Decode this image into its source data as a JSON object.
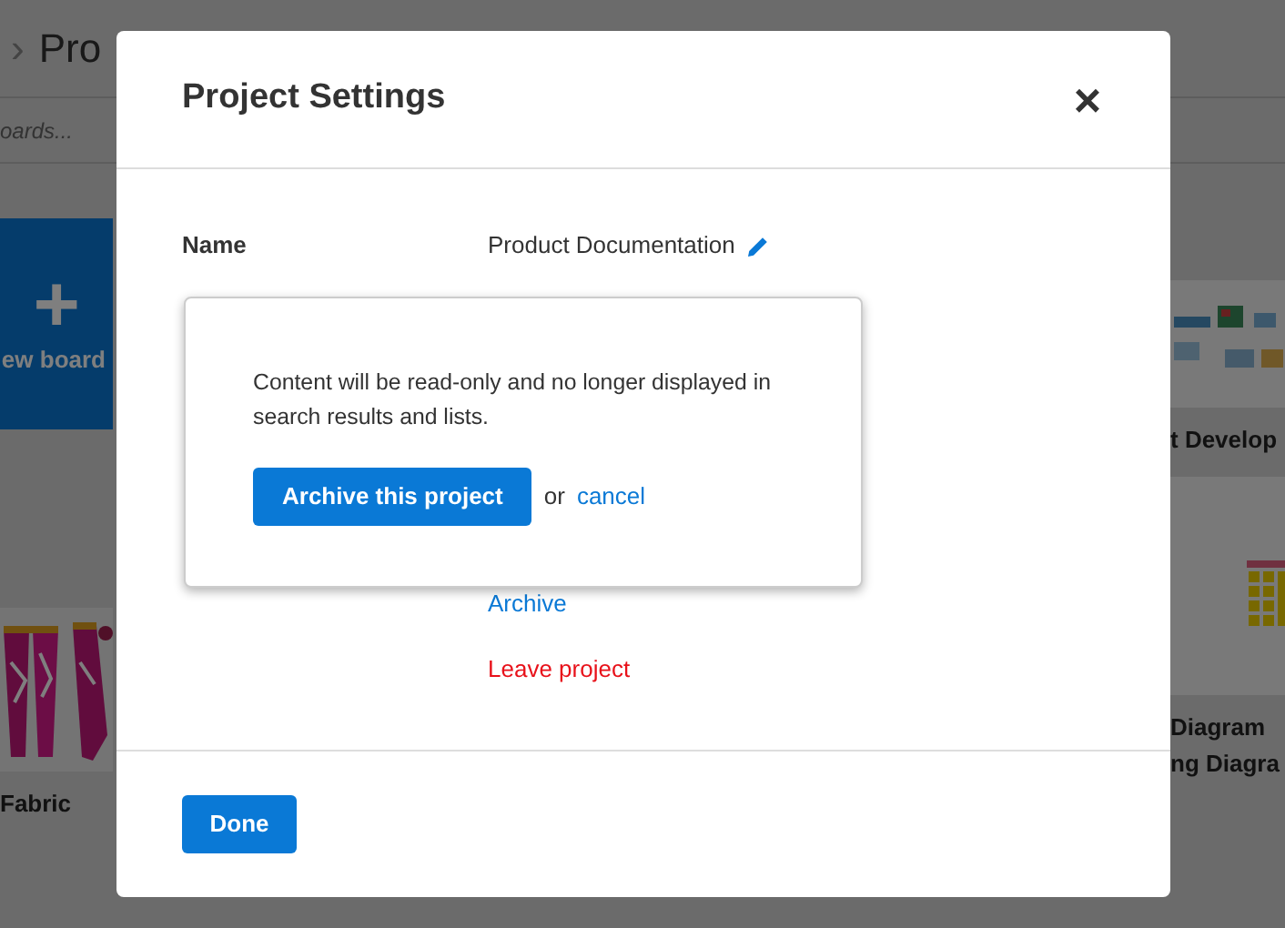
{
  "background": {
    "breadcrumb": {
      "separator": "›",
      "title": "Pro"
    },
    "search": {
      "placeholder": "oards..."
    },
    "new_board": {
      "icon": "+",
      "label": "ew board"
    },
    "left_boards": [
      {
        "kind": "picture",
        "title_lines": [
          "Fabric"
        ]
      }
    ],
    "right_boards": [
      {
        "kind": "picture",
        "title_lines": [
          "t Develop"
        ]
      },
      {
        "kind": "picture",
        "title_lines": [
          "Diagram",
          "ng Diagra"
        ]
      }
    ]
  },
  "modal": {
    "title": "Project Settings",
    "close": "×",
    "fields": [
      {
        "label": "Name",
        "value": "Product Documentation",
        "editable": true
      }
    ],
    "popover": {
      "message": "Content will be read-only and no longer displayed in search results and lists.",
      "confirm": "Archive this project",
      "or": "or",
      "cancel": "cancel"
    },
    "actions": [
      {
        "label": "Archive",
        "kind": "link"
      },
      {
        "label": "Leave project",
        "kind": "danger"
      }
    ],
    "done": "Done"
  }
}
